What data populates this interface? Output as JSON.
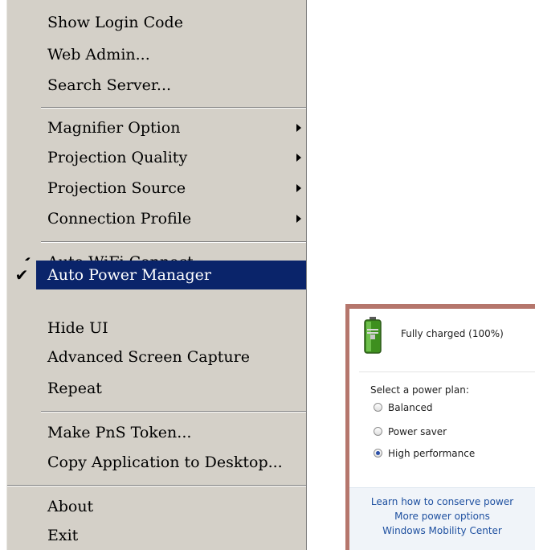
{
  "menu": {
    "items": [
      {
        "label": "Show Login Code"
      },
      {
        "label": "Web Admin..."
      },
      {
        "label": "Search Server..."
      },
      {
        "label": "Magnifier Option"
      },
      {
        "label": "Projection Quality"
      },
      {
        "label": "Projection Source"
      },
      {
        "label": "Connection Profile"
      },
      {
        "label": "Auto WiFi Connect",
        "checked": true
      },
      {
        "label": "Auto Power Manager",
        "checked": true,
        "selected": true
      },
      {
        "label": "Hide UI"
      },
      {
        "label": "Advanced Screen Capture"
      },
      {
        "label": "Repeat"
      },
      {
        "label": "Make PnS Token..."
      },
      {
        "label": "Copy Application to Desktop..."
      },
      {
        "label": "About"
      },
      {
        "label": "Exit"
      }
    ],
    "check_glyph": "✔",
    "colors": {
      "background": "#d4d0c8",
      "highlight": "#0a246a"
    }
  },
  "power_flyout": {
    "battery_icon": "battery-full-icon",
    "status": "Fully charged (100%)",
    "plan_title": "Select a power plan:",
    "plans": [
      {
        "label": "Balanced",
        "selected": false
      },
      {
        "label": "Power saver",
        "selected": false
      },
      {
        "label": "High performance",
        "selected": true
      }
    ],
    "links": [
      "Learn how to conserve power",
      "More power options",
      "Windows Mobility Center"
    ],
    "colors": {
      "border": "#b5766c",
      "link": "#1e50a0"
    }
  }
}
